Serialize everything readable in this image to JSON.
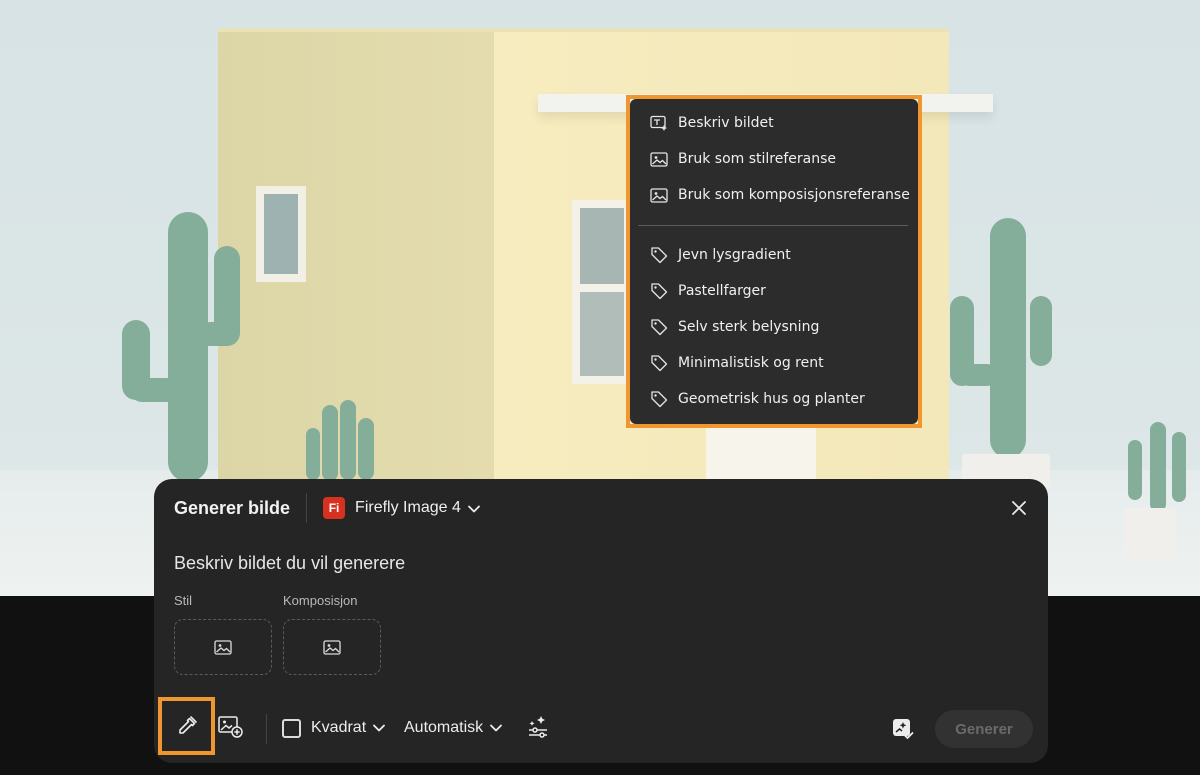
{
  "context_menu": {
    "actions": [
      {
        "label": "Beskriv bildet",
        "icon": "describe-image-icon"
      },
      {
        "label": "Bruk som stilreferanse",
        "icon": "image-icon"
      },
      {
        "label": "Bruk som komposisjonsreferanse",
        "icon": "image-icon"
      }
    ],
    "tags": [
      {
        "label": "Jevn lysgradient",
        "icon": "tag-icon"
      },
      {
        "label": "Pastellfarger",
        "icon": "tag-icon"
      },
      {
        "label": "Selv sterk belysning",
        "icon": "tag-icon"
      },
      {
        "label": "Minimalistisk og rent",
        "icon": "tag-icon"
      },
      {
        "label": "Geometrisk hus og planter",
        "icon": "tag-icon"
      }
    ]
  },
  "panel": {
    "title": "Generer bilde",
    "model_badge": "Fi",
    "model_label": "Firefly Image 4",
    "prompt_placeholder": "Beskriv bildet du vil generere",
    "style_label": "Stil",
    "composition_label": "Komposisjon",
    "toolbar": {
      "aspect_label": "Kvadrat",
      "content_type_label": "Automatisk",
      "generate_label": "Generer"
    }
  },
  "colors": {
    "highlight": "#f0962e",
    "panel_bg": "#252525",
    "menu_bg": "#2c2c2c",
    "firefly_red": "#d7321f"
  }
}
